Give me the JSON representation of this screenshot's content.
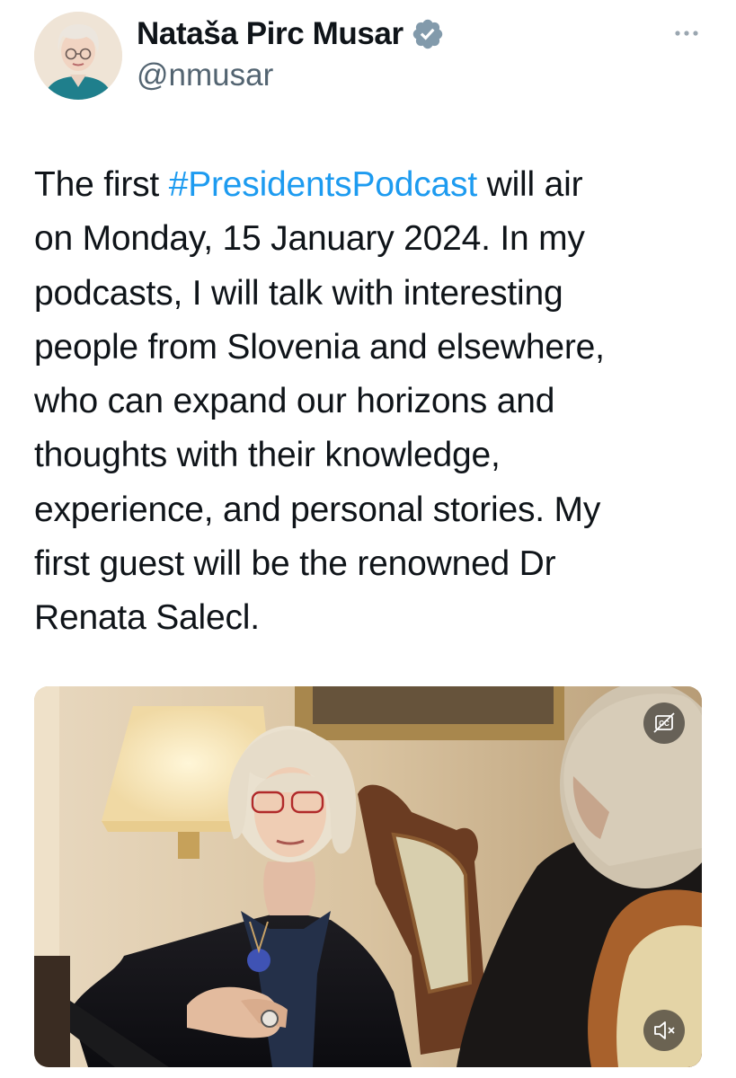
{
  "author": {
    "display_name": "Nataša Pirc Musar",
    "handle": "@nmusar",
    "verified": true,
    "verified_icon": "verified-badge-icon",
    "avatar_icon": "profile-avatar"
  },
  "menu": {
    "more_icon": "more-options-icon"
  },
  "tweet": {
    "lines": [
      {
        "before": "The first ",
        "hashtag": "#PresidentsPodcast",
        "after": " will air"
      },
      {
        "text": "on Monday, 15 January 2024. In my"
      },
      {
        "text": "podcasts, I will talk with interesting"
      },
      {
        "text": "people from Slovenia and elsewhere,"
      },
      {
        "text": "who can expand our horizons and"
      },
      {
        "text": "thoughts with their knowledge,"
      },
      {
        "text": "experience, and personal stories. My"
      },
      {
        "text": "first guest will be the renowned Dr"
      },
      {
        "text": "Renata Salecl."
      }
    ]
  },
  "video": {
    "captions_icon": "closed-captions-icon",
    "mute_icon": "speaker-muted-icon"
  },
  "colors": {
    "text": "#0f1419",
    "secondary": "#536471",
    "hashtag": "#1d9bf0",
    "verified": "#829aab"
  }
}
